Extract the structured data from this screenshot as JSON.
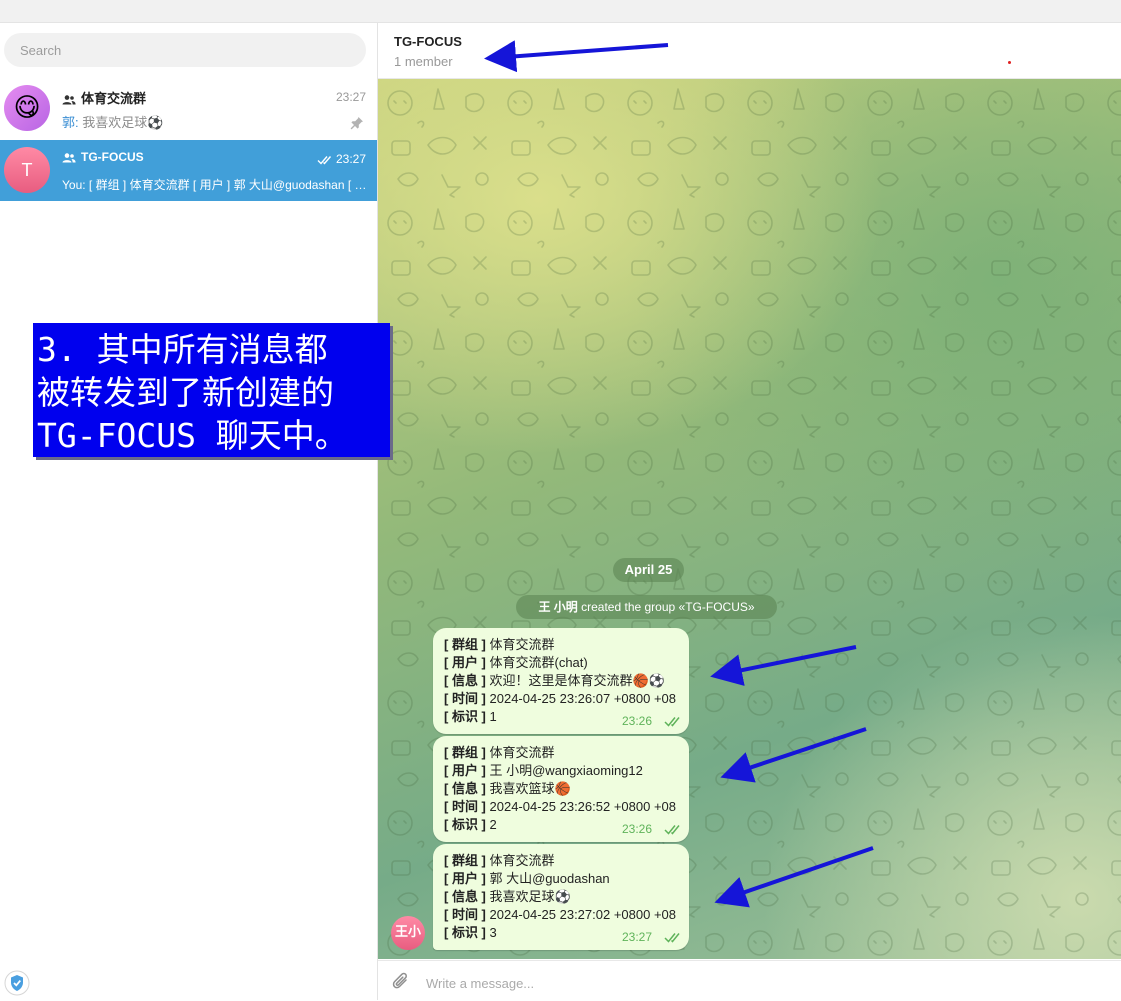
{
  "sidebar": {
    "search_placeholder": "Search",
    "chats": [
      {
        "title": "体育交流群",
        "time": "23:27",
        "sender": "郭:",
        "preview": "我喜欢足球⚽",
        "avatar": "😋",
        "pinned": true
      },
      {
        "title": "TG-FOCUS",
        "time": "23:27",
        "preview": "You: [ 群组 ] 体育交流群 [ 用户 ] 郭 大山@guodashan [ 信息 ] 我喜欢足球⚽",
        "avatar": "T",
        "selected": true
      }
    ]
  },
  "annotation": {
    "lines": [
      "3. 其中所有消息都",
      "被转发到了新创建的",
      "TG-FOCUS 聊天中。"
    ]
  },
  "header": {
    "title": "TG-FOCUS",
    "subtitle": "1 member"
  },
  "conversation": {
    "date": "April 25",
    "service_name": "王 小明",
    "service_text": " created the group «TG-FOCUS»",
    "labels": {
      "group": "[ 群组 ]",
      "user": "[ 用户 ]",
      "info": "[ 信息 ]",
      "time": "[ 时间 ]",
      "id": "[ 标识 ]"
    },
    "messages": [
      {
        "group": " 体育交流群",
        "user": " 体育交流群(chat)",
        "info": " 欢迎！这里是体育交流群🏀⚽",
        "time": " 2024-04-25 23:26:07 +0800 +08",
        "id": " 1",
        "sent": "23:26"
      },
      {
        "group": " 体育交流群",
        "user": " 王 小明@wangxiaoming12",
        "info": " 我喜欢篮球🏀",
        "time": " 2024-04-25 23:26:52 +0800 +08",
        "id": " 2",
        "sent": "23:26"
      },
      {
        "group": " 体育交流群",
        "user": " 郭 大山@guodashan",
        "info": " 我喜欢足球⚽",
        "time": " 2024-04-25 23:27:02 +0800 +08",
        "id": " 3",
        "sent": "23:27"
      }
    ],
    "sender_avatar": "王小"
  },
  "composer": {
    "placeholder": "Write a message..."
  },
  "colors": {
    "selected_chat": "#419fd9",
    "annotation_bg": "#0000ee",
    "arrow": "#1515d8",
    "bubble": "#effdde",
    "ticks": "#5fb35a"
  }
}
